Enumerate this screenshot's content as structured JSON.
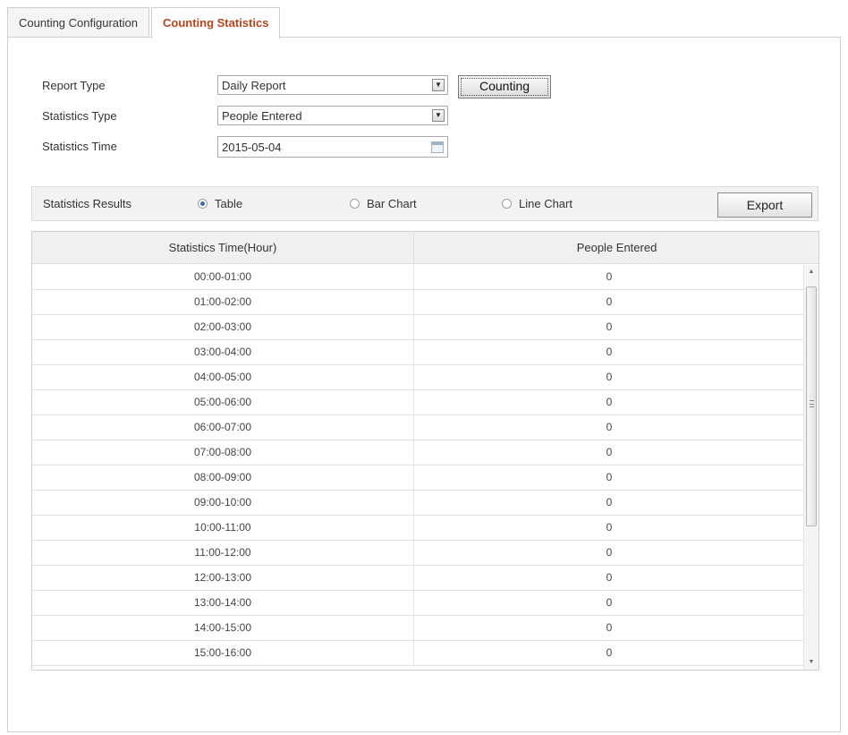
{
  "tabs": [
    {
      "label": "Counting Configuration",
      "active": false
    },
    {
      "label": "Counting Statistics",
      "active": true
    }
  ],
  "form": {
    "report_type": {
      "label": "Report Type",
      "value": "Daily Report"
    },
    "statistics_type": {
      "label": "Statistics Type",
      "value": "People Entered"
    },
    "statistics_time": {
      "label": "Statistics Time",
      "value": "2015-05-04"
    },
    "counting_button": "Counting"
  },
  "results": {
    "label": "Statistics Results",
    "options": [
      {
        "label": "Table",
        "checked": true
      },
      {
        "label": "Bar Chart",
        "checked": false
      },
      {
        "label": "Line Chart",
        "checked": false
      }
    ],
    "export_button": "Export"
  },
  "table": {
    "columns": [
      "Statistics Time(Hour)",
      "People Entered"
    ],
    "rows": [
      {
        "time": "00:00-01:00",
        "count": "0"
      },
      {
        "time": "01:00-02:00",
        "count": "0"
      },
      {
        "time": "02:00-03:00",
        "count": "0"
      },
      {
        "time": "03:00-04:00",
        "count": "0"
      },
      {
        "time": "04:00-05:00",
        "count": "0"
      },
      {
        "time": "05:00-06:00",
        "count": "0"
      },
      {
        "time": "06:00-07:00",
        "count": "0"
      },
      {
        "time": "07:00-08:00",
        "count": "0"
      },
      {
        "time": "08:00-09:00",
        "count": "0"
      },
      {
        "time": "09:00-10:00",
        "count": "0"
      },
      {
        "time": "10:00-11:00",
        "count": "0"
      },
      {
        "time": "11:00-12:00",
        "count": "0"
      },
      {
        "time": "12:00-13:00",
        "count": "0"
      },
      {
        "time": "13:00-14:00",
        "count": "0"
      },
      {
        "time": "14:00-15:00",
        "count": "0"
      },
      {
        "time": "15:00-16:00",
        "count": "0"
      }
    ]
  },
  "colors": {
    "active_tab": "#b5451b",
    "radio_checked": "#3a6ea5"
  }
}
